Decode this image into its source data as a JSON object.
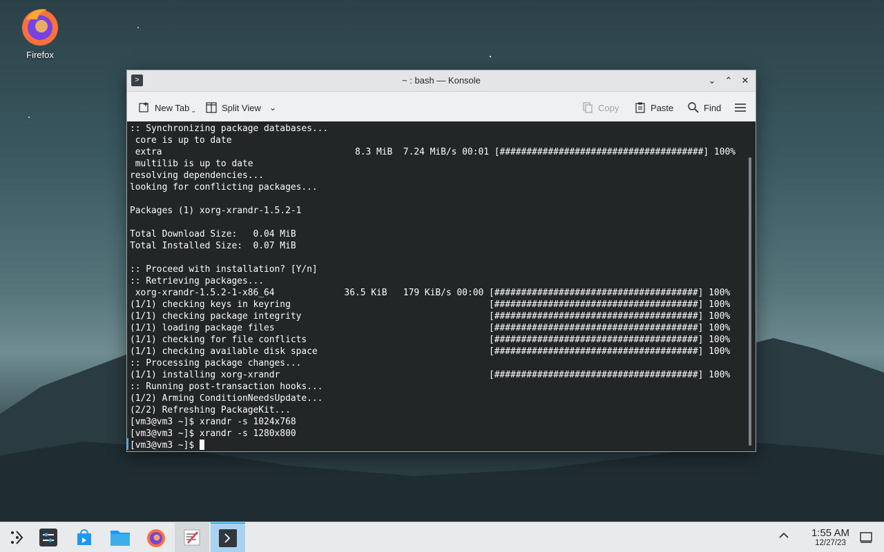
{
  "desktop": {
    "icons": [
      {
        "label": "Firefox",
        "icon": "firefox-icon"
      }
    ]
  },
  "window": {
    "title": "~ : bash — Konsole",
    "controls": [
      "minimize-icon",
      "maximize-icon",
      "close-icon"
    ],
    "toolbar": {
      "new_tab": "New Tab",
      "split_view": "Split View",
      "copy": "Copy",
      "paste": "Paste",
      "find": "Find"
    }
  },
  "terminal": {
    "lines": [
      ":: Synchronizing package databases...",
      " core is up to date",
      " extra                                    8.3 MiB  7.24 MiB/s 00:01 [######################################] 100%",
      " multilib is up to date",
      "resolving dependencies...",
      "looking for conflicting packages...",
      "",
      "Packages (1) xorg-xrandr-1.5.2-1",
      "",
      "Total Download Size:   0.04 MiB",
      "Total Installed Size:  0.07 MiB",
      "",
      ":: Proceed with installation? [Y/n]",
      ":: Retrieving packages...",
      " xorg-xrandr-1.5.2-1-x86_64             36.5 KiB   179 KiB/s 00:00 [######################################] 100%",
      "(1/1) checking keys in keyring                                     [######################################] 100%",
      "(1/1) checking package integrity                                   [######################################] 100%",
      "(1/1) loading package files                                        [######################################] 100%",
      "(1/1) checking for file conflicts                                  [######################################] 100%",
      "(1/1) checking available disk space                                [######################################] 100%",
      ":: Processing package changes...",
      "(1/1) installing xorg-xrandr                                       [######################################] 100%",
      ":: Running post-transaction hooks...",
      "(1/2) Arming ConditionNeedsUpdate...",
      "(2/2) Refreshing PackageKit...",
      "[vm3@vm3 ~]$ xrandr -s 1024x768",
      "[vm3@vm3 ~]$ xrandr -s 1280x800"
    ],
    "prompt": "[vm3@vm3 ~]$ "
  },
  "taskbar": {
    "items": [
      "application-launcher-icon",
      "system-settings-icon",
      "discover-icon",
      "dolphin-icon",
      "firefox-icon",
      "kate-icon",
      "konsole-icon"
    ],
    "clock": {
      "time": "1:55 AM",
      "date": "12/27/23"
    }
  },
  "colors": {
    "accent": "#3daee9",
    "terminal_bg": "#232627",
    "terminal_fg": "#fcfcfc"
  }
}
